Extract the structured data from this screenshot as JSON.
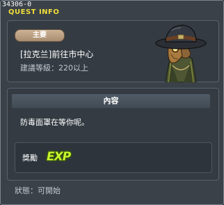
{
  "quest_id": "34306-0",
  "window_title": "QUEST INFO",
  "header": {
    "badge_label": "主要",
    "quest_name": "[拉克兰]前往市中心",
    "level_requirement": "建議等級：220以上",
    "portrait_icon": "plague-doctor-npc-portrait"
  },
  "content": {
    "header_label": "內容",
    "description": "防毒面罩在等你呢。",
    "reward": {
      "label": "獎勵",
      "exp_text": "EXP",
      "exp_color": "#c9f52c"
    }
  },
  "status_text": "狀態：可開始",
  "colors": {
    "title": "#f2de3a",
    "window_bg": "#3a4148",
    "panel_bg": "#343b42",
    "badge_bg": "#ceb396"
  }
}
